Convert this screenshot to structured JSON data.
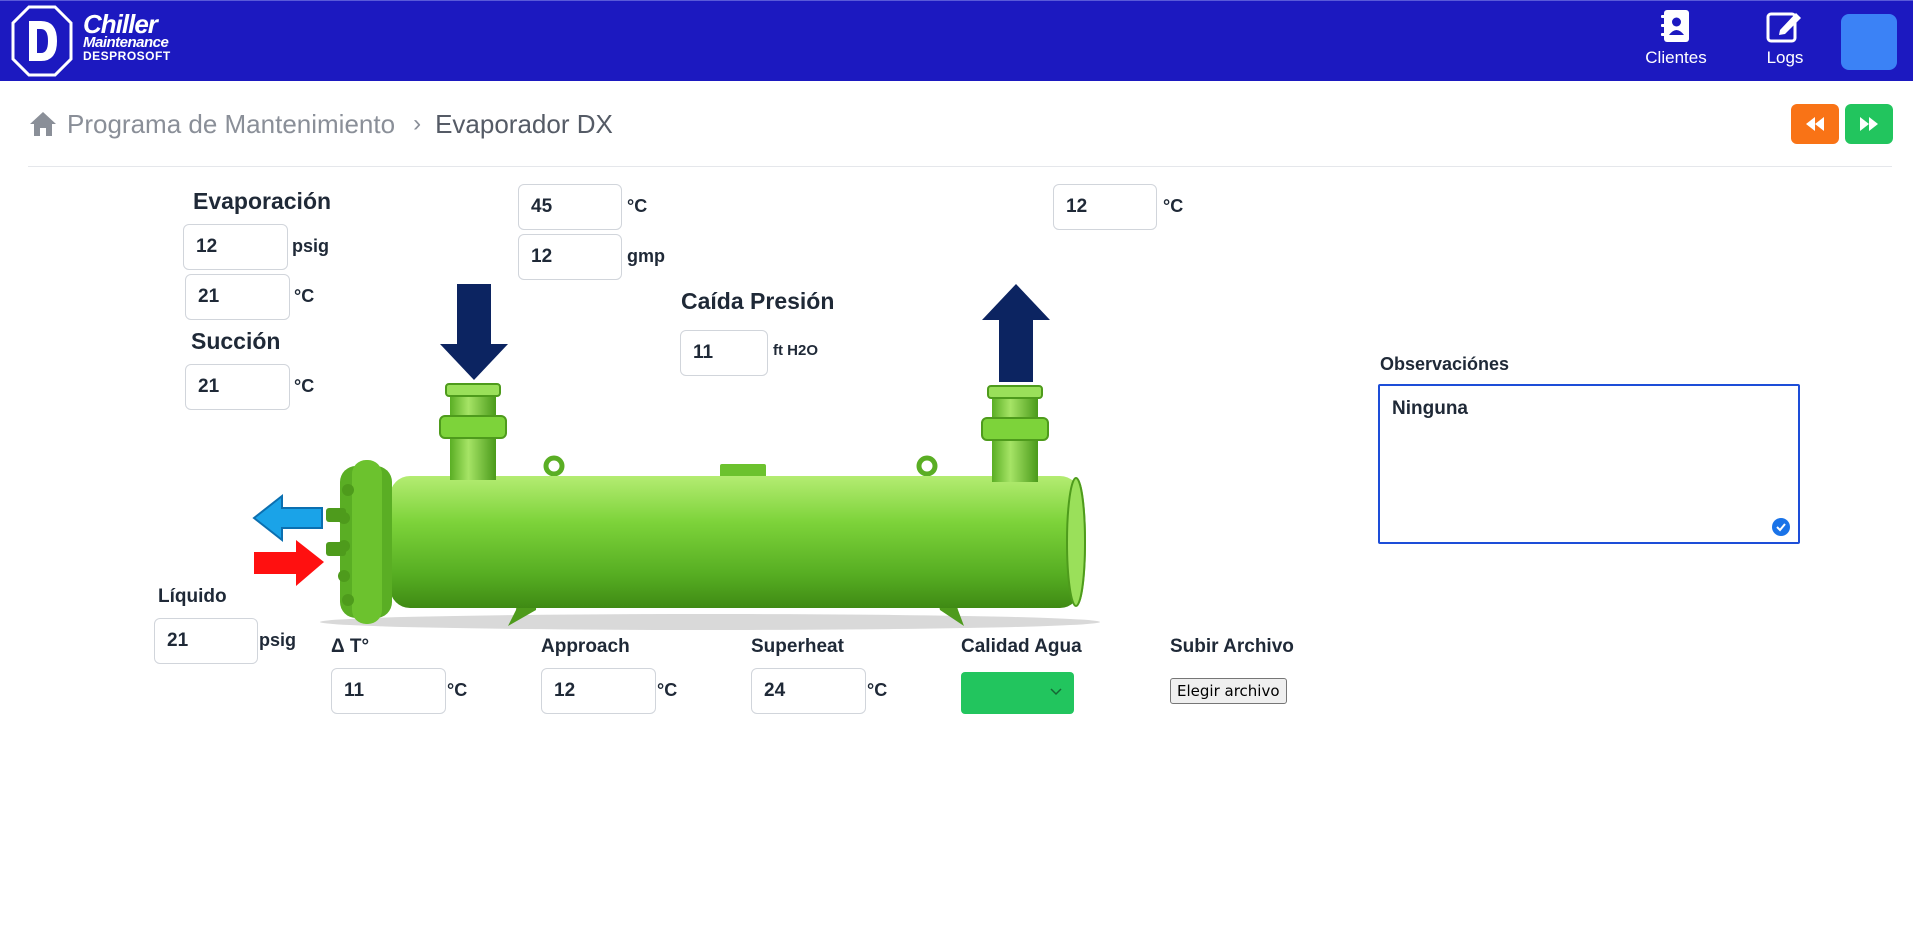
{
  "header": {
    "logo": {
      "line1": "Chiller",
      "line2": "Maintenance",
      "line3": "DESPROSOFT"
    },
    "nav": [
      {
        "label": "Clientes",
        "icon": "address-book-icon"
      },
      {
        "label": "Logs",
        "icon": "edit-icon"
      }
    ],
    "colors": {
      "bar": "#1c19c0",
      "avatar": "#3b82f6"
    }
  },
  "breadcrumb": {
    "home": "Programa de Mantenimiento",
    "current": "Evaporador DX"
  },
  "controls": {
    "prev_color": "#f97316",
    "next_color": "#22c55e"
  },
  "evaporacion": {
    "title": "Evaporación",
    "pressure": "12",
    "pressure_unit": "psig",
    "temp": "21",
    "temp_unit": "°C"
  },
  "succion": {
    "title": "Succión",
    "temp": "21",
    "temp_unit": "°C"
  },
  "agua_entrada": {
    "temp": "45",
    "temp_unit": "°C",
    "flow": "12",
    "flow_unit": "gmp"
  },
  "caida_presion": {
    "title": "Caída Presión",
    "value": "11",
    "unit": "ft H2O"
  },
  "agua_salida": {
    "temp": "12",
    "temp_unit": "°C"
  },
  "liquido": {
    "title": "Líquido",
    "pressure": "21",
    "pressure_unit": "psig"
  },
  "delta_t": {
    "title": "Δ T°",
    "value": "11",
    "unit": "°C"
  },
  "approach": {
    "title": "Approach",
    "value": "12",
    "unit": "°C"
  },
  "superheat": {
    "title": "Superheat",
    "value": "24",
    "unit": "°C"
  },
  "calidad_agua": {
    "title": "Calidad Agua",
    "color": "#22c55e"
  },
  "subir_archivo": {
    "title": "Subir Archivo",
    "button": "Elegir archivo"
  },
  "observaciones": {
    "title": "Observaciónes",
    "value": "Ninguna"
  }
}
